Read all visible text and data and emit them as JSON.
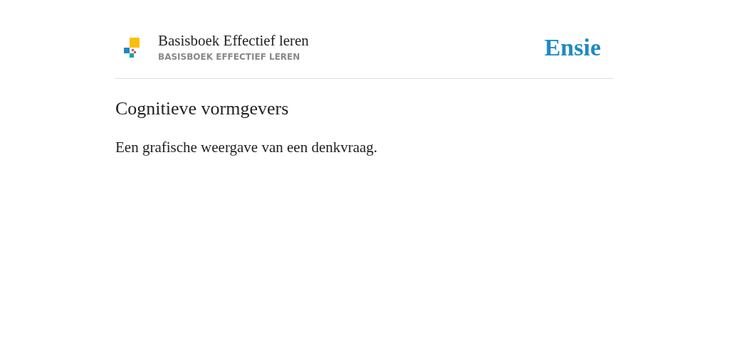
{
  "header": {
    "title": "Basisboek Effectief leren",
    "subtitle": "BASISBOEK EFFECTIEF LEREN",
    "brand": "Ensie"
  },
  "article": {
    "heading": "Cognitieve vormgevers",
    "text": "Een grafische weergave van een denkvraag."
  }
}
